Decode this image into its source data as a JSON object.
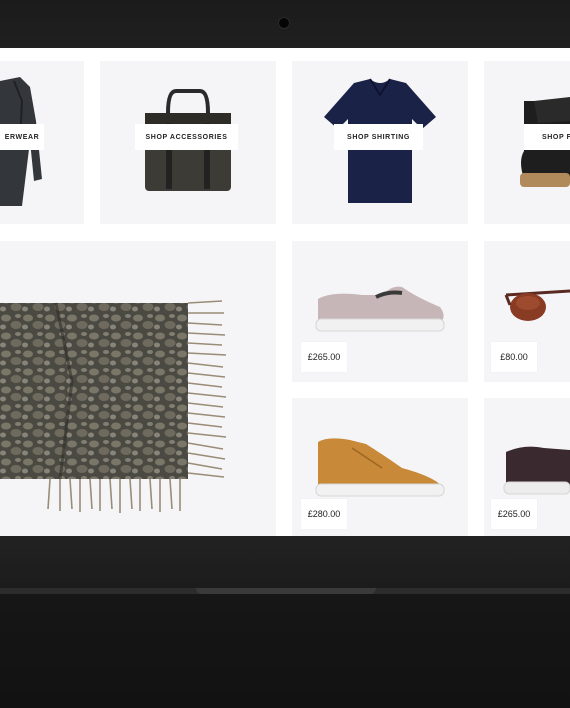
{
  "categories": [
    {
      "label": "SHOP OUTERWEAR",
      "visible": "ERWEAR"
    },
    {
      "label": "SHOP ACCESSORIES",
      "visible": "SHOP ACCESSORIES"
    },
    {
      "label": "SHOP SHIRTING",
      "visible": "SHOP SHIRTING"
    },
    {
      "label": "SHOP FOOTWEAR",
      "visible": "SHOP FO"
    }
  ],
  "products": [
    {
      "name": "suede slip-on sneaker",
      "price": "£265.00"
    },
    {
      "name": "sunglasses",
      "price": "£80.00"
    },
    {
      "name": "tan suede high-top",
      "price": "£280.00"
    },
    {
      "name": "dark suede sneaker",
      "price": "£265.00"
    }
  ],
  "colors": {
    "tile_bg": "#f5f5f7",
    "bezel": "#1b1b1b"
  }
}
